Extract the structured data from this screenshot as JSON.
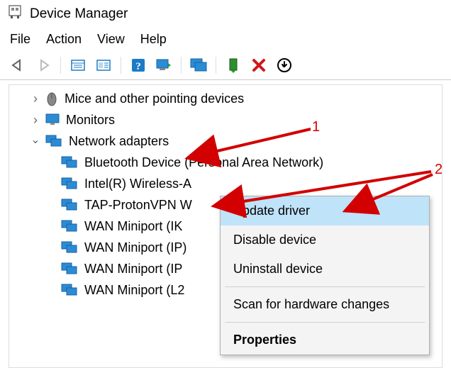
{
  "window": {
    "title": "Device Manager"
  },
  "menu": {
    "file": "File",
    "action": "Action",
    "view": "View",
    "help": "Help"
  },
  "toolbar": {
    "back": "back",
    "forward": "forward",
    "showhide": "showhide",
    "properties": "properties",
    "help": "help",
    "refresh": "refresh",
    "displays": "displays",
    "update": "update",
    "remove": "remove",
    "scan": "scan"
  },
  "tree": {
    "mice": {
      "label": "Mice and other pointing devices"
    },
    "monitors": {
      "label": "Monitors"
    },
    "network": {
      "label": "Network adapters",
      "children": [
        {
          "label": "Bluetooth Device (Personal Area Network)"
        },
        {
          "label": "Intel(R) Wireless-A"
        },
        {
          "label": "TAP-ProtonVPN W"
        },
        {
          "label": "WAN Miniport (IK"
        },
        {
          "label": "WAN Miniport (IP)"
        },
        {
          "label": "WAN Miniport (IP"
        },
        {
          "label": "WAN Miniport (L2"
        }
      ]
    }
  },
  "context_menu": {
    "update": "Update driver",
    "disable": "Disable device",
    "uninstall": "Uninstall device",
    "scan": "Scan for hardware changes",
    "properties": "Properties"
  },
  "annotations": {
    "one": "1",
    "two": "2"
  }
}
